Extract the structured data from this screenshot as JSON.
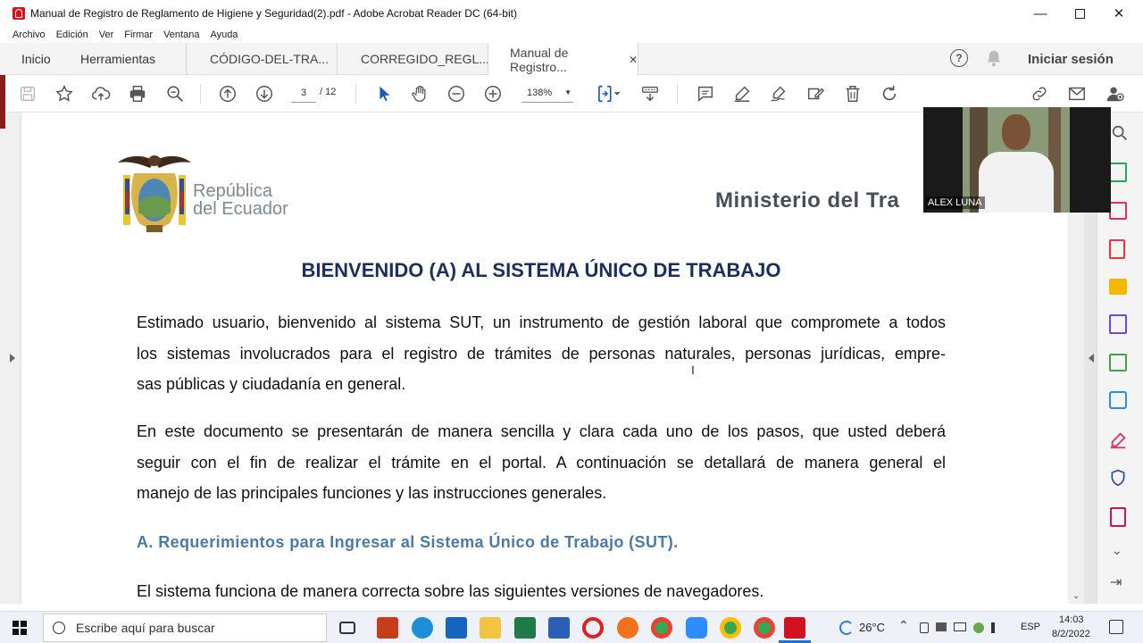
{
  "window": {
    "title": "Manual de Registro de Reglamento de Higiene y Seguridad(2).pdf - Adobe Acrobat Reader DC (64-bit)"
  },
  "menu": [
    "Archivo",
    "Edición",
    "Ver",
    "Firmar",
    "Ventana",
    "Ayuda"
  ],
  "tabs": {
    "home": "Inicio",
    "tools": "Herramientas",
    "docs": [
      "CÓDIGO-DEL-TRA...",
      "CORREGIDO_REGL...",
      "Manual de Registro..."
    ]
  },
  "header": {
    "signin": "Iniciar sesión"
  },
  "toolbar": {
    "page_current": "3",
    "page_total": "/ 12",
    "zoom": "138%"
  },
  "doc": {
    "logo_line1": "República",
    "logo_line2": "del Ecuador",
    "ministry": "Ministerio del Tra",
    "heading": "BIENVENIDO (A) AL SISTEMA ÚNICO DE TRABAJO",
    "para1_l1": "Estimado usuario, bienvenido al sistema SUT, un instrumento de gestión laboral que compromete a todos",
    "para1_l2": "los sistemas involucrados para el registro de trámites de personas naturales, personas jurídicas, empre-",
    "para1_l3": "sas públicas y ciudadanía en general.",
    "para2_l1": "En este documento se presentarán de manera sencilla y clara cada uno de los pasos, que usted deberá",
    "para2_l2": "seguir con el fin de realizar el trámite en el portal. A continuación se detallará de manera general el",
    "para2_l3": "manejo de las principales funciones y las instrucciones generales.",
    "section": "A. Requerimientos para Ingresar al Sistema Único de Trabajo (SUT).",
    "para3": "El sistema funciona de manera correcta sobre las siguientes versiones de navegadores."
  },
  "video": {
    "name": "ALEX LUNA"
  },
  "taskbar": {
    "search_placeholder": "Escribe aquí para buscar",
    "temp": "26°C",
    "lang": "ESP",
    "time": "14:03",
    "date": "8/2/2022"
  },
  "colors": {
    "heading": "#1b2f5e",
    "section": "#4a7aa8",
    "accent": "#1473e6"
  }
}
